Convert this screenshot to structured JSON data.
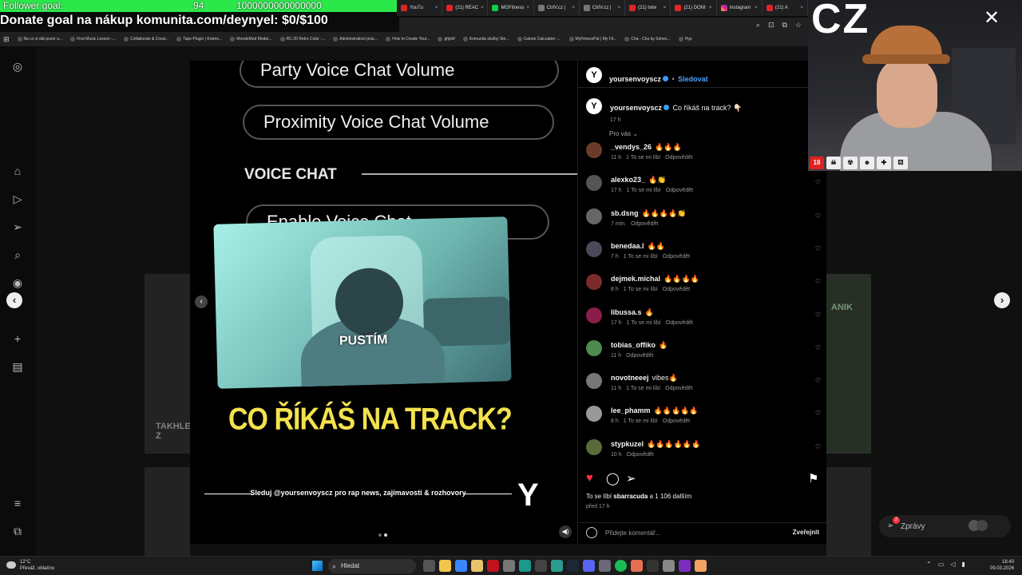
{
  "overlay": {
    "goal_label": "Follower goal:",
    "goal_count": "94",
    "goal_amount": "1000000000000000",
    "donate_text": "Donate goal na nákup komunita.com/deynyel: $0/$100"
  },
  "browser": {
    "tabs": [
      {
        "label": "YouTu",
        "icon": "youtube-icon"
      },
      {
        "label": "(21) REAC",
        "icon": "youtube-icon"
      },
      {
        "label": "MGFitness",
        "icon": "kick-icon"
      },
      {
        "label": "CtrlV.cz |",
        "icon": "page-icon"
      },
      {
        "label": "CtrlV.cz |",
        "icon": "page-icon"
      },
      {
        "label": "(21) tvtw",
        "icon": "youtube-icon"
      },
      {
        "label": "(21) DONI",
        "icon": "youtube-icon"
      },
      {
        "label": "Instagram",
        "icon": "instagram-icon"
      },
      {
        "label": "(21) A",
        "icon": "youtube-icon"
      }
    ],
    "bookmarks": [
      "Na co si dát pozor u...",
      "First Music Lesson -...",
      "Collaborate & Creat...",
      "Tape Plugin | Krame...",
      "MondoMod Modul...",
      "RC-20 Retro Color -...",
      "Administrativní prac...",
      "How to Create Your...",
      "ghjshf",
      "Komunita služby Ste...",
      "Calorie Calculator -...",
      "MyFitnessPal | My Fit...",
      "Cha - Cha by Simon...",
      "Hyp"
    ]
  },
  "reel": {
    "menu_items": [
      "Party Voice Chat Volume",
      "Proximity Voice Chat Volume"
    ],
    "section_title": "VOICE CHAT",
    "partial_item": "Enable Voice Chat",
    "video_caption": "PUSTÍM",
    "headline": "CO ŘÍKÁŠ NA TRACK?",
    "follow_text": "Sleduj @yoursenvoyscz pro rap news, zajímavosti & rozhovory",
    "logo_letter": "Y",
    "background_left_text": "TAKHLE Z",
    "background_right_text": "ANIK"
  },
  "panel": {
    "header_user": "yoursenvoyscz",
    "follow_label": "Sledovat",
    "caption_user": "yoursenvoyscz",
    "caption_text": "Co říkáš na track? 👇🏻",
    "caption_time": "17 h",
    "sort_label": "Pro vás",
    "reply_label": "Odpovědět",
    "comments": [
      {
        "user": "_vendys_26",
        "text": "🔥🔥🔥",
        "time": "11 h",
        "likes": "1 To se mi líbí"
      },
      {
        "user": "alexko23_",
        "text": "🔥👏",
        "time": "17 h",
        "likes": "1 To se mi líbí"
      },
      {
        "user": "sb.dsng",
        "text": "🔥🔥🔥🔥👏",
        "time": "7 min.",
        "likes": ""
      },
      {
        "user": "benedaa.l",
        "text": "🔥🔥",
        "time": "7 h",
        "likes": "1 To se mi líbí"
      },
      {
        "user": "dejmek.michal",
        "text": "🔥🔥🔥🔥",
        "time": "8 h",
        "likes": "1 To se mi líbí"
      },
      {
        "user": "libussa.s",
        "text": "🔥",
        "time": "17 h",
        "likes": "1 To se mi líbí"
      },
      {
        "user": "tobias_offiko",
        "text": "🔥",
        "time": "11 h",
        "likes": ""
      },
      {
        "user": "novotneeej",
        "text": "vibes🔥",
        "time": "11 h",
        "likes": "1 To se mi líbí"
      },
      {
        "user": "lee_phamm",
        "text": "🔥🔥🔥🔥🔥",
        "time": "8 h",
        "likes": "1 To se mi líbí"
      },
      {
        "user": "stypkuzel",
        "text": "🔥🔥🔥🔥🔥🔥",
        "time": "10 h",
        "likes": ""
      }
    ],
    "likes_prefix": "To se líbí",
    "likes_user": "sbarracuda",
    "likes_suffix": "a 1 106 dalším",
    "post_age": "před 17 h",
    "comment_placeholder": "Přidejte komentář...",
    "post_label": "Zveřejnit"
  },
  "messages": {
    "label": "Zprávy",
    "badge": "2"
  },
  "webcam": {
    "text": "CZ",
    "age_badge": "18"
  },
  "taskbar": {
    "weather_temp": "12°C",
    "weather_desc": "Převáž. oblačno",
    "search_label": "Hledat",
    "time": "18:40",
    "date": "09.03.2026"
  }
}
